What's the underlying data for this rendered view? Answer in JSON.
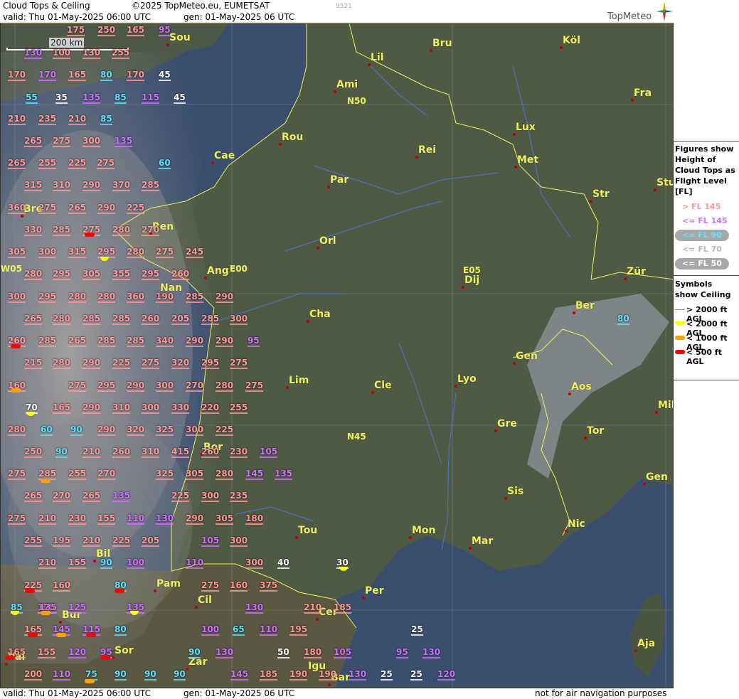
{
  "header": {
    "title": "Cloud Tops & Ceiling",
    "copyright": "©2025 TopMeteo.eu, EUMETSAT",
    "valid": "valid:  Thu  01-May-2025  06:00 UTC",
    "gen": "gen: 01-May-2025 06 UTC",
    "code": "9521",
    "brand": "TopMeteo"
  },
  "footer": {
    "valid": "valid:  Thu  01-May-2025  06:00 UTC",
    "gen": "gen: 01-May-2025 06 UTC",
    "disclaimer": "not for air navigation purposes"
  },
  "scale_label": "200 km",
  "colors": {
    "fl_high": "#ff9898",
    "fl_mid": "#d070ff",
    "fl_low": "#60e0ff",
    "fl_lower": "#b8b8b8",
    "fl_lowest": "#ffffff"
  },
  "grid_labels": [
    "N50",
    "N45",
    "E05",
    "E00",
    "W05"
  ],
  "cities": [
    {
      "name": "Sou"
    },
    {
      "name": "Bru"
    },
    {
      "name": "Köl"
    },
    {
      "name": "Lil"
    },
    {
      "name": "Ami"
    },
    {
      "name": "Fra"
    },
    {
      "name": "Rou"
    },
    {
      "name": "Lux"
    },
    {
      "name": "Cae"
    },
    {
      "name": "Rei"
    },
    {
      "name": "Met"
    },
    {
      "name": "Par"
    },
    {
      "name": "Str"
    },
    {
      "name": "Stu"
    },
    {
      "name": "Bre"
    },
    {
      "name": "Ren"
    },
    {
      "name": "Orl"
    },
    {
      "name": "Ang"
    },
    {
      "name": "Dij"
    },
    {
      "name": "Zür"
    },
    {
      "name": "Nan"
    },
    {
      "name": "Cha"
    },
    {
      "name": "Ber"
    },
    {
      "name": "Gen"
    },
    {
      "name": "Lim"
    },
    {
      "name": "Cle"
    },
    {
      "name": "Lyo"
    },
    {
      "name": "Aos"
    },
    {
      "name": "Mil"
    },
    {
      "name": "Gre"
    },
    {
      "name": "Tor"
    },
    {
      "name": "Bor"
    },
    {
      "name": "Sis"
    },
    {
      "name": "Gen"
    },
    {
      "name": "Tou"
    },
    {
      "name": "Mon"
    },
    {
      "name": "Mar"
    },
    {
      "name": "Nic"
    },
    {
      "name": "Bil"
    },
    {
      "name": "Pam"
    },
    {
      "name": "Per"
    },
    {
      "name": "Cil"
    },
    {
      "name": "Bur"
    },
    {
      "name": "Cer"
    },
    {
      "name": "Sor"
    },
    {
      "name": "Val"
    },
    {
      "name": "Zar"
    },
    {
      "name": "Igu"
    },
    {
      "name": "Aja"
    },
    {
      "name": "Bar"
    }
  ],
  "flight_levels": [
    {
      "v": "175",
      "c": "high"
    },
    {
      "v": "250",
      "c": "high"
    },
    {
      "v": "165",
      "c": "high"
    },
    {
      "v": "95",
      "c": "mid"
    },
    {
      "v": "130",
      "c": "mid"
    },
    {
      "v": "100",
      "c": "high"
    },
    {
      "v": "130",
      "c": "high"
    },
    {
      "v": "255",
      "c": "high"
    },
    {
      "v": "170",
      "c": "high"
    },
    {
      "v": "170",
      "c": "mid"
    },
    {
      "v": "165",
      "c": "high"
    },
    {
      "v": "80",
      "c": "low"
    },
    {
      "v": "170",
      "c": "high"
    },
    {
      "v": "45",
      "c": "lowest"
    },
    {
      "v": "55",
      "c": "low"
    },
    {
      "v": "35",
      "c": "lowest"
    },
    {
      "v": "135",
      "c": "mid"
    },
    {
      "v": "85",
      "c": "low"
    },
    {
      "v": "115",
      "c": "mid"
    },
    {
      "v": "45",
      "c": "lowest"
    },
    {
      "v": "210",
      "c": "high"
    },
    {
      "v": "235",
      "c": "high"
    },
    {
      "v": "210",
      "c": "high"
    },
    {
      "v": "85",
      "c": "low"
    },
    {
      "v": "265",
      "c": "high"
    },
    {
      "v": "275",
      "c": "high"
    },
    {
      "v": "300",
      "c": "high"
    },
    {
      "v": "135",
      "c": "mid"
    },
    {
      "v": "265",
      "c": "high"
    },
    {
      "v": "255",
      "c": "high"
    },
    {
      "v": "225",
      "c": "high"
    },
    {
      "v": "275",
      "c": "high"
    },
    {
      "v": "60",
      "c": "low"
    },
    {
      "v": "315",
      "c": "high"
    },
    {
      "v": "310",
      "c": "high"
    },
    {
      "v": "290",
      "c": "high"
    },
    {
      "v": "370",
      "c": "high"
    },
    {
      "v": "285",
      "c": "high"
    },
    {
      "v": "360",
      "c": "high"
    },
    {
      "v": "275",
      "c": "high"
    },
    {
      "v": "265",
      "c": "high"
    },
    {
      "v": "290",
      "c": "high"
    },
    {
      "v": "225",
      "c": "high"
    },
    {
      "v": "330",
      "c": "high"
    },
    {
      "v": "285",
      "c": "high"
    },
    {
      "v": "275",
      "c": "high"
    },
    {
      "v": "280",
      "c": "high"
    },
    {
      "v": "270",
      "c": "high"
    },
    {
      "v": "305",
      "c": "high"
    },
    {
      "v": "300",
      "c": "high"
    },
    {
      "v": "315",
      "c": "high"
    },
    {
      "v": "295",
      "c": "high"
    },
    {
      "v": "280",
      "c": "high"
    },
    {
      "v": "275",
      "c": "high"
    },
    {
      "v": "245",
      "c": "high"
    },
    {
      "v": "280",
      "c": "high"
    },
    {
      "v": "295",
      "c": "high"
    },
    {
      "v": "305",
      "c": "high"
    },
    {
      "v": "355",
      "c": "high"
    },
    {
      "v": "295",
      "c": "high"
    },
    {
      "v": "260",
      "c": "high"
    },
    {
      "v": "300",
      "c": "high"
    },
    {
      "v": "295",
      "c": "high"
    },
    {
      "v": "280",
      "c": "high"
    },
    {
      "v": "280",
      "c": "high"
    },
    {
      "v": "360",
      "c": "high"
    },
    {
      "v": "190",
      "c": "high"
    },
    {
      "v": "285",
      "c": "high"
    },
    {
      "v": "290",
      "c": "high"
    },
    {
      "v": "265",
      "c": "high"
    },
    {
      "v": "280",
      "c": "high"
    },
    {
      "v": "285",
      "c": "high"
    },
    {
      "v": "285",
      "c": "high"
    },
    {
      "v": "260",
      "c": "high"
    },
    {
      "v": "205",
      "c": "high"
    },
    {
      "v": "285",
      "c": "high"
    },
    {
      "v": "300",
      "c": "high"
    },
    {
      "v": "260",
      "c": "high"
    },
    {
      "v": "285",
      "c": "high"
    },
    {
      "v": "265",
      "c": "high"
    },
    {
      "v": "285",
      "c": "high"
    },
    {
      "v": "285",
      "c": "high"
    },
    {
      "v": "340",
      "c": "high"
    },
    {
      "v": "290",
      "c": "high"
    },
    {
      "v": "290",
      "c": "high"
    },
    {
      "v": "95",
      "c": "mid"
    },
    {
      "v": "215",
      "c": "high"
    },
    {
      "v": "280",
      "c": "high"
    },
    {
      "v": "290",
      "c": "high"
    },
    {
      "v": "225",
      "c": "high"
    },
    {
      "v": "275",
      "c": "high"
    },
    {
      "v": "320",
      "c": "high"
    },
    {
      "v": "295",
      "c": "high"
    },
    {
      "v": "275",
      "c": "high"
    },
    {
      "v": "160",
      "c": "high"
    },
    {
      "v": "275",
      "c": "high"
    },
    {
      "v": "295",
      "c": "high"
    },
    {
      "v": "290",
      "c": "high"
    },
    {
      "v": "300",
      "c": "high"
    },
    {
      "v": "270",
      "c": "high"
    },
    {
      "v": "280",
      "c": "high"
    },
    {
      "v": "275",
      "c": "high"
    },
    {
      "v": "70",
      "c": "lowest"
    },
    {
      "v": "165",
      "c": "high"
    },
    {
      "v": "290",
      "c": "high"
    },
    {
      "v": "310",
      "c": "high"
    },
    {
      "v": "300",
      "c": "high"
    },
    {
      "v": "330",
      "c": "high"
    },
    {
      "v": "220",
      "c": "high"
    },
    {
      "v": "255",
      "c": "high"
    },
    {
      "v": "280",
      "c": "high"
    },
    {
      "v": "60",
      "c": "low"
    },
    {
      "v": "90",
      "c": "low"
    },
    {
      "v": "290",
      "c": "high"
    },
    {
      "v": "320",
      "c": "high"
    },
    {
      "v": "325",
      "c": "high"
    },
    {
      "v": "300",
      "c": "high"
    },
    {
      "v": "225",
      "c": "high"
    },
    {
      "v": "250",
      "c": "high"
    },
    {
      "v": "90",
      "c": "low"
    },
    {
      "v": "210",
      "c": "high"
    },
    {
      "v": "260",
      "c": "high"
    },
    {
      "v": "310",
      "c": "high"
    },
    {
      "v": "415",
      "c": "high"
    },
    {
      "v": "260",
      "c": "high"
    },
    {
      "v": "230",
      "c": "high"
    },
    {
      "v": "105",
      "c": "mid"
    },
    {
      "v": "275",
      "c": "high"
    },
    {
      "v": "285",
      "c": "high"
    },
    {
      "v": "255",
      "c": "high"
    },
    {
      "v": "270",
      "c": "high"
    },
    {
      "v": "325",
      "c": "high"
    },
    {
      "v": "305",
      "c": "high"
    },
    {
      "v": "280",
      "c": "high"
    },
    {
      "v": "145",
      "c": "mid"
    },
    {
      "v": "135",
      "c": "mid"
    },
    {
      "v": "265",
      "c": "high"
    },
    {
      "v": "270",
      "c": "high"
    },
    {
      "v": "265",
      "c": "high"
    },
    {
      "v": "135",
      "c": "mid"
    },
    {
      "v": "225",
      "c": "high"
    },
    {
      "v": "300",
      "c": "high"
    },
    {
      "v": "235",
      "c": "high"
    },
    {
      "v": "275",
      "c": "high"
    },
    {
      "v": "210",
      "c": "high"
    },
    {
      "v": "230",
      "c": "high"
    },
    {
      "v": "155",
      "c": "high"
    },
    {
      "v": "110",
      "c": "mid"
    },
    {
      "v": "130",
      "c": "mid"
    },
    {
      "v": "290",
      "c": "high"
    },
    {
      "v": "305",
      "c": "high"
    },
    {
      "v": "180",
      "c": "high"
    },
    {
      "v": "255",
      "c": "high"
    },
    {
      "v": "195",
      "c": "high"
    },
    {
      "v": "210",
      "c": "high"
    },
    {
      "v": "225",
      "c": "high"
    },
    {
      "v": "205",
      "c": "high"
    },
    {
      "v": "105",
      "c": "mid"
    },
    {
      "v": "300",
      "c": "high"
    },
    {
      "v": "210",
      "c": "high"
    },
    {
      "v": "155",
      "c": "high"
    },
    {
      "v": "90",
      "c": "low"
    },
    {
      "v": "100",
      "c": "mid"
    },
    {
      "v": "110",
      "c": "mid"
    },
    {
      "v": "300",
      "c": "high"
    },
    {
      "v": "40",
      "c": "lowest"
    },
    {
      "v": "30",
      "c": "lowest"
    },
    {
      "v": "225",
      "c": "high"
    },
    {
      "v": "160",
      "c": "high"
    },
    {
      "v": "80",
      "c": "low"
    },
    {
      "v": "275",
      "c": "high"
    },
    {
      "v": "160",
      "c": "high"
    },
    {
      "v": "375",
      "c": "high"
    },
    {
      "v": "85",
      "c": "low"
    },
    {
      "v": "175",
      "c": "high"
    },
    {
      "v": "135",
      "c": "mid"
    },
    {
      "v": "125",
      "c": "mid"
    },
    {
      "v": "135",
      "c": "mid"
    },
    {
      "v": "130",
      "c": "mid"
    },
    {
      "v": "210",
      "c": "high"
    },
    {
      "v": "185",
      "c": "high"
    },
    {
      "v": "165",
      "c": "high"
    },
    {
      "v": "145",
      "c": "mid"
    },
    {
      "v": "115",
      "c": "mid"
    },
    {
      "v": "80",
      "c": "low"
    },
    {
      "v": "100",
      "c": "mid"
    },
    {
      "v": "65",
      "c": "low"
    },
    {
      "v": "110",
      "c": "mid"
    },
    {
      "v": "195",
      "c": "high"
    },
    {
      "v": "25",
      "c": "lowest"
    },
    {
      "v": "165",
      "c": "high"
    },
    {
      "v": "155",
      "c": "high"
    },
    {
      "v": "120",
      "c": "mid"
    },
    {
      "v": "95",
      "c": "mid"
    },
    {
      "v": "90",
      "c": "low"
    },
    {
      "v": "130",
      "c": "mid"
    },
    {
      "v": "50",
      "c": "lowest"
    },
    {
      "v": "180",
      "c": "high"
    },
    {
      "v": "105",
      "c": "mid"
    },
    {
      "v": "95",
      "c": "mid"
    },
    {
      "v": "130",
      "c": "mid"
    },
    {
      "v": "200",
      "c": "high"
    },
    {
      "v": "110",
      "c": "mid"
    },
    {
      "v": "75",
      "c": "low"
    },
    {
      "v": "90",
      "c": "low"
    },
    {
      "v": "90",
      "c": "low"
    },
    {
      "v": "90",
      "c": "low"
    },
    {
      "v": "145",
      "c": "mid"
    },
    {
      "v": "185",
      "c": "high"
    },
    {
      "v": "190",
      "c": "high"
    },
    {
      "v": "190",
      "c": "high"
    },
    {
      "v": "130",
      "c": "mid"
    },
    {
      "v": "25",
      "c": "lowest"
    },
    {
      "v": "25",
      "c": "lowest"
    },
    {
      "v": "120",
      "c": "mid"
    },
    {
      "v": "80",
      "c": "low"
    }
  ],
  "ceiling_symbols": [
    {
      "type": "red"
    },
    {
      "type": "yellow"
    },
    {
      "type": "red"
    },
    {
      "type": "orange"
    },
    {
      "type": "yellow"
    },
    {
      "type": "orange"
    },
    {
      "type": "yellow"
    },
    {
      "type": "red"
    },
    {
      "type": "red"
    },
    {
      "type": "yellow"
    },
    {
      "type": "orange"
    },
    {
      "type": "yellow"
    },
    {
      "type": "red"
    },
    {
      "type": "orange"
    },
    {
      "type": "red"
    },
    {
      "type": "red"
    },
    {
      "type": "red"
    },
    {
      "type": "orange"
    }
  ],
  "legend": {
    "figures_title": "Figures show Height of Cloud Tops as Flight Level  [FL]",
    "fl_items": [
      {
        "label": "> FL 145",
        "c": "high"
      },
      {
        "label": "<= FL 145",
        "c": "mid"
      },
      {
        "label": "<= FL 90",
        "c": "low"
      },
      {
        "label": "<= FL 70",
        "c": "lower"
      },
      {
        "label": "<= FL 50",
        "c": "lowest"
      }
    ],
    "symbols_title": "Symbols show Ceiling",
    "symbol_items": [
      {
        "label": "> 2000 ft AGL",
        "type": "none"
      },
      {
        "label": "< 2000 ft AGL",
        "type": "yellow"
      },
      {
        "label": "< 1000 ft AGL",
        "type": "orange"
      },
      {
        "label": "< 500 ft AGL",
        "type": "red"
      }
    ]
  }
}
